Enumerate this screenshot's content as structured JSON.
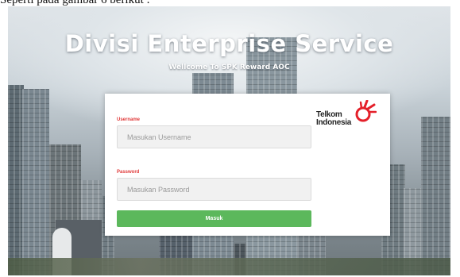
{
  "caption": "Seperti pada gambar 6 berikut :",
  "page": {
    "title": "Divisi Enterprise Service",
    "subtitle": "Wellcome To SPK Reward AOC"
  },
  "login": {
    "username_label": "Username",
    "username_placeholder": "Masukan Username",
    "password_label": "Password",
    "password_placeholder": "Masukan Password",
    "submit_label": "Masuk"
  },
  "logo": {
    "line1": "Telkom",
    "line2": "Indonesia",
    "icon": "telkom-logo-icon"
  },
  "colors": {
    "accent_green": "#5cb85c",
    "label_red": "#e03a3a",
    "logo_red": "#e4202a"
  }
}
